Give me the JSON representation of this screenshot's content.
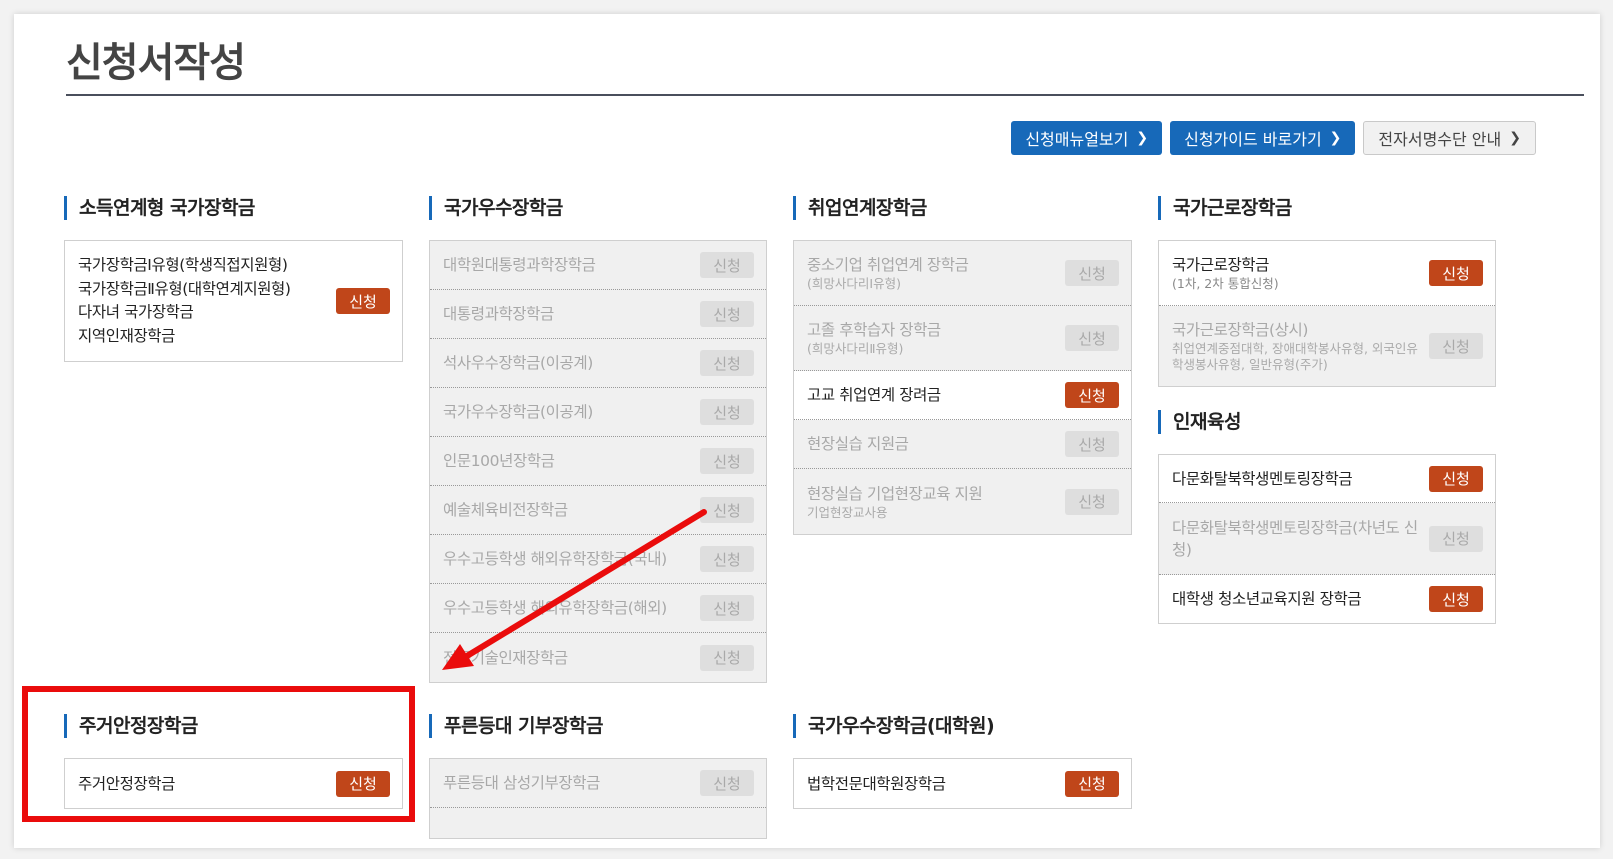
{
  "page_title": "신청서작성",
  "top_buttons": [
    {
      "label": "신청매뉴얼보기",
      "style": "blue"
    },
    {
      "label": "신청가이드 바로가기",
      "style": "blue"
    },
    {
      "label": "전자서명수단 안내",
      "style": "gray"
    }
  ],
  "apply_label": "신청",
  "colors": {
    "accent_blue": "#1769b9",
    "apply_active": "#c0461a",
    "highlight_red": "#ea0c0c"
  },
  "sections": {
    "income": {
      "title": "소득연계형 국가장학금",
      "lines": [
        "국가장학금Ⅰ유형(학생직접지원형)",
        "국가장학금Ⅱ유형(대학연계지원형)",
        "다자녀 국가장학금",
        "지역인재장학금"
      ]
    },
    "excellence": {
      "title": "국가우수장학금",
      "items": [
        "대학원대통령과학장학금",
        "대통령과학장학금",
        "석사우수장학금(이공계)",
        "국가우수장학금(이공계)",
        "인문100년장학금",
        "예술체육비전장학금",
        "우수고등학생 해외유학장학금(국내)",
        "우수고등학생 해외유학장학금(해외)",
        "전문기술인재장학금"
      ]
    },
    "employment": {
      "title": "취업연계장학금",
      "items": [
        {
          "name": "중소기업 취업연계 장학금",
          "sub": "(희망사다리Ⅰ유형)"
        },
        {
          "name": "고졸 후학습자 장학금",
          "sub": "(희망사다리Ⅱ유형)"
        },
        {
          "name": "고교 취업연계 장려금",
          "sub": ""
        },
        {
          "name": "현장실습 지원금",
          "sub": ""
        },
        {
          "name": "현장실습 기업현장교육 지원",
          "sub": "기업현장교사용"
        }
      ]
    },
    "work": {
      "title": "국가근로장학금",
      "items": [
        {
          "name": "국가근로장학금",
          "sub": "(1차, 2차 통합신청)"
        },
        {
          "name": "국가근로장학금(상시)",
          "sub": "취업연계중점대학, 장애대학봉사유형, 외국인유학생봉사유형, 일반유형(주가)"
        }
      ]
    },
    "talent": {
      "title": "인재육성",
      "items": [
        "다문화탈북학생멘토링장학금",
        "다문화탈북학생멘토링장학금(차년도 신청)",
        "대학생 청소년교육지원 장학금"
      ]
    },
    "housing": {
      "title": "주거안정장학금",
      "items": [
        "주거안정장학금"
      ]
    },
    "donation": {
      "title": "푸른등대 기부장학금",
      "items": [
        "푸른등대 삼성기부장학금"
      ]
    },
    "graduate": {
      "title": "국가우수장학금(대학원)",
      "items": [
        "법학전문대학원장학금"
      ]
    }
  }
}
